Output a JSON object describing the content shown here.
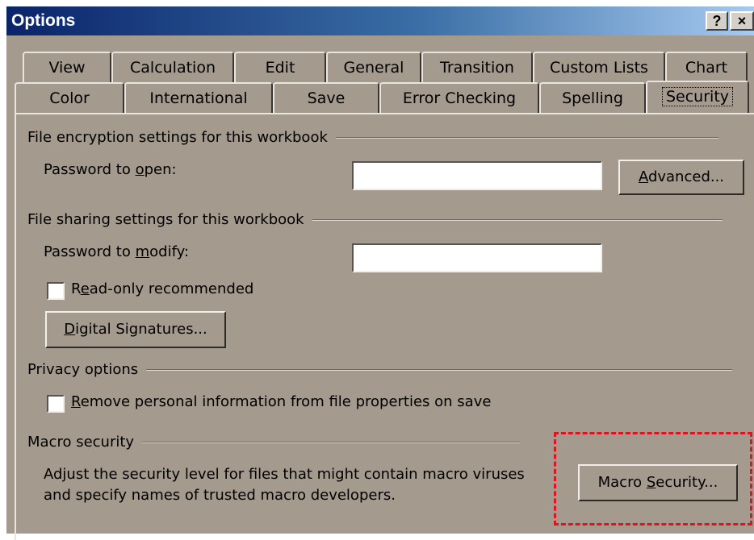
{
  "window": {
    "title": "Options",
    "help_button": "?",
    "close_button": "×"
  },
  "tabs_row1": [
    "View",
    "Calculation",
    "Edit",
    "General",
    "Transition",
    "Custom Lists",
    "Chart"
  ],
  "tabs_row2": [
    "Color",
    "International",
    "Save",
    "Error Checking",
    "Spelling",
    "Security"
  ],
  "active_tab": "Security",
  "groups": {
    "encryption": {
      "title": "File encryption settings for this workbook",
      "password_label_pre": "Password to ",
      "password_label_u": "o",
      "password_label_post": "pen:",
      "password_value": "",
      "advanced_pre": "",
      "advanced_u": "A",
      "advanced_post": "dvanced..."
    },
    "sharing": {
      "title": "File sharing settings for this workbook",
      "modify_label_pre": "Password to ",
      "modify_label_u": "m",
      "modify_label_post": "odify:",
      "modify_value": "",
      "readonly_pre": "R",
      "readonly_u": "e",
      "readonly_post": "ad-only recommended",
      "readonly_checked": false,
      "digsig_pre": "",
      "digsig_u": "D",
      "digsig_post": "igital Signatures..."
    },
    "privacy": {
      "title": "Privacy options",
      "remove_pre": "",
      "remove_u": "R",
      "remove_post": "emove personal information from file properties on save",
      "remove_checked": false
    },
    "macro": {
      "title": "Macro security",
      "desc_line1": "Adjust the security level for files that might contain macro viruses",
      "desc_line2": "and specify names of trusted macro developers.",
      "button_pre": "Macro ",
      "button_u": "S",
      "button_post": "ecurity..."
    }
  },
  "colors": {
    "dialog_bg": "#a49a8e",
    "titlebar_start": "#0a246a",
    "titlebar_end": "#a6caf0",
    "highlight": "#e0141e"
  }
}
